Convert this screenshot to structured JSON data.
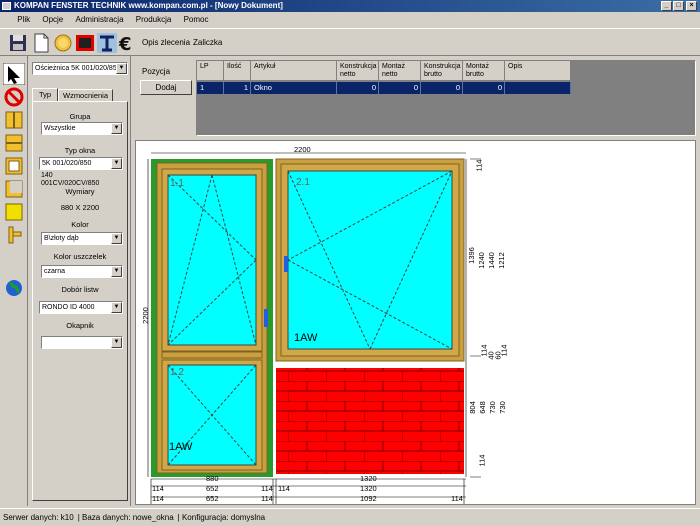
{
  "window": {
    "title": "KOMPAN FENSTER TECHNIK www.kompan.com.pl - [Nowy Dokument]"
  },
  "menu": [
    "Plik",
    "Opcje",
    "Administracja",
    "Produkcja",
    "Pomoc"
  ],
  "toolbar": {
    "opis_label": "Opis zlecenia",
    "zaliczka_label": "Zaliczka",
    "icons": [
      "save-icon",
      "new-document-icon",
      "coins-icon",
      "frame-red-icon",
      "tools-icon",
      "euro-icon"
    ]
  },
  "props": {
    "frame_select": "Ościeżnica 5K 001/020/850",
    "tab_typ": "Typ",
    "tab_wzmocnienia": "Wzmocnienia",
    "grupa_label": "Grupa",
    "grupa_value": "Wszystkie",
    "typ_okna_label": "Typ okna",
    "typ_okna_value": "5K 001/020/850",
    "typ_okna_extra": "140",
    "typ_okna_extra2": "001CV/020CV/850",
    "wymiary_label": "Wymiary",
    "wymiary_value": "880 X 2200",
    "kolor_label": "Kolor",
    "kolor_value": "B\\złoty dąb",
    "uszczelek_label": "Kolor uszczelek",
    "uszczelek_value": "czarna",
    "listw_label": "Dobór listw",
    "listw_value": "RONDO ID 4000",
    "okapnik_label": "Okapnik",
    "okapnik_value": ""
  },
  "position": {
    "label": "Pozycja",
    "add_button": "Dodaj"
  },
  "grid": {
    "headers": [
      "LP",
      "Ilość",
      "Artykuł",
      "Konstrukcja netto",
      "Montaż netto",
      "Konstrukcja brutto",
      "Montaż brutto",
      "Opis"
    ],
    "rows": [
      [
        "1",
        "1",
        "Okno",
        "0",
        "0",
        "0",
        "0",
        ""
      ]
    ]
  },
  "drawing": {
    "sash_labels": [
      "1.1",
      "2.1",
      "1.2"
    ],
    "glass_labels": [
      "1AW",
      "1AW"
    ],
    "top_dim": "2200",
    "left_dim": "2200",
    "right_top_dims": [
      "114",
      "1396",
      "1240",
      "1440",
      "1212"
    ],
    "right_mid_dims": [
      "114",
      "40",
      "60",
      "114"
    ],
    "right_bottom_dims": [
      "804",
      "648",
      "730",
      "730",
      "114"
    ],
    "bottom_row1": [
      "880",
      "1320"
    ],
    "bottom_row2": [
      "114",
      "652",
      "114",
      "114",
      "1320"
    ],
    "bottom_row3": [
      "114",
      "652",
      "114",
      "1092",
      "114"
    ]
  },
  "status": {
    "server": "Serwer danych:  k10",
    "db": "Baza danych:  nowe_okna",
    "config": "Konfiguracja:  domyslna"
  },
  "colors": {
    "titlebar": "#0a246a",
    "glass": "#00ffff",
    "frame": "#c8a040",
    "green_frame": "#2a9a2a",
    "brick": "#ff0000",
    "selected_row": "#0a246a"
  }
}
